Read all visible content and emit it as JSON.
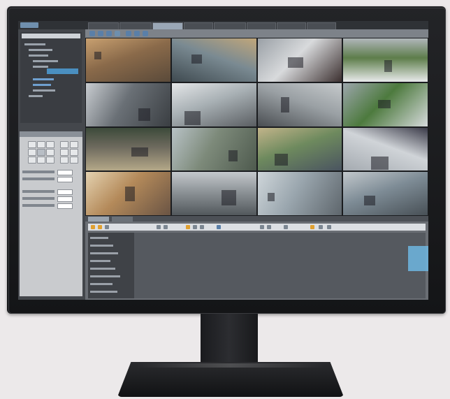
{
  "scene": {
    "subject": "computer-monitor-on-stand",
    "accent": "#4a8fc0",
    "background": "#ece9ea"
  },
  "app": {
    "type": "video-surveillance-client",
    "camera_grid": {
      "rows": 4,
      "cols": 4
    },
    "tabs": 8
  }
}
